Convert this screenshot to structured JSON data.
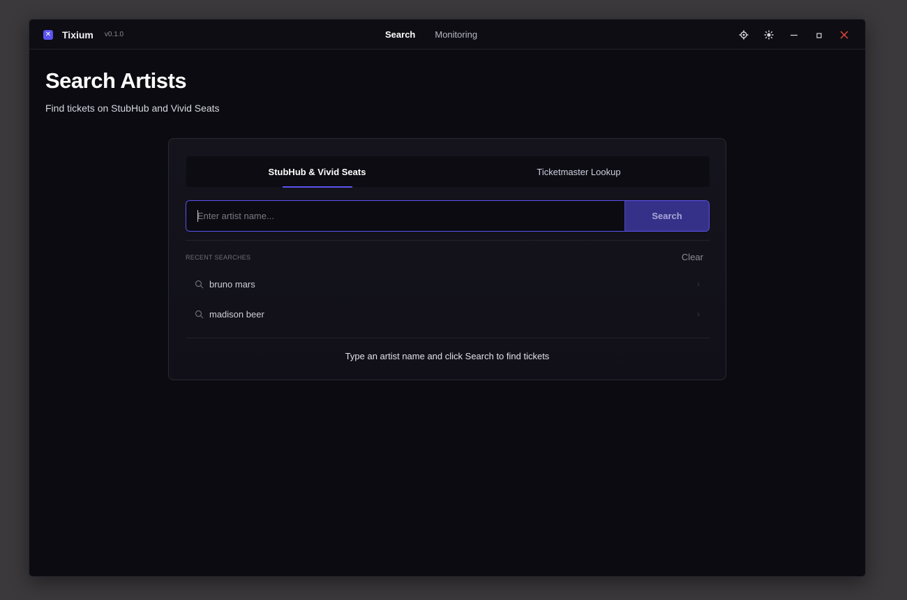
{
  "app": {
    "name": "Tixium",
    "version": "v0.1.0",
    "logo_glyph": "✕",
    "accent_color": "#5b53f0"
  },
  "nav": {
    "items": [
      {
        "label": "Search",
        "active": true
      },
      {
        "label": "Monitoring",
        "active": false
      }
    ]
  },
  "window_controls": {
    "icons": [
      "settings-gear-icon",
      "theme-sun-icon",
      "minimize-icon",
      "maximize-icon",
      "close-icon"
    ],
    "close_color": "#e5483f"
  },
  "page": {
    "title": "Search Artists",
    "subtitle": "Find tickets on StubHub and Vivid Seats"
  },
  "search_card": {
    "tabs": [
      {
        "label": "StubHub & Vivid Seats",
        "active": true
      },
      {
        "label": "Ticketmaster Lookup",
        "active": false
      }
    ],
    "input": {
      "placeholder": "Enter artist name...",
      "value": ""
    },
    "search_button": "Search",
    "recent": {
      "label": "RECENT SEARCHES",
      "clear_label": "Clear",
      "items": [
        {
          "text": "bruno mars",
          "icon": "search-icon"
        },
        {
          "text": "madison beer",
          "icon": "search-icon"
        }
      ]
    },
    "hint": "Type an artist name and click Search to find tickets"
  }
}
